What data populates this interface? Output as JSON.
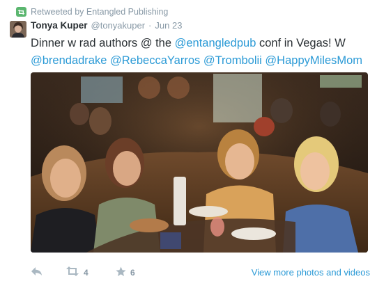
{
  "retweet_context": {
    "text": "Retweeted by Entangled Publishing",
    "icon": "retweet-icon"
  },
  "tweet": {
    "author_name": "Tonya Kuper",
    "author_handle": "@tonyakuper",
    "separator": "·",
    "date": "Jun 23",
    "text": {
      "lead": "Dinner w rad authors @ the ",
      "mention_1": "@entangledpub",
      "middle": " conf in Vegas! W",
      "mentions_line2": [
        "@brendadrake",
        "@RebeccaYarros",
        "@Trombolii",
        "@HappyMilesMom"
      ]
    }
  },
  "actions": {
    "reply_icon": "reply-icon",
    "retweet_icon": "retweet-icon",
    "retweet_count": "4",
    "favorite_icon": "star-icon",
    "favorite_count": "6",
    "view_more_label": "View more photos and videos"
  },
  "colors": {
    "link": "#2b9ad6",
    "muted": "#8899a6",
    "text": "#292f33",
    "retweet_badge": "#5bb66f"
  }
}
